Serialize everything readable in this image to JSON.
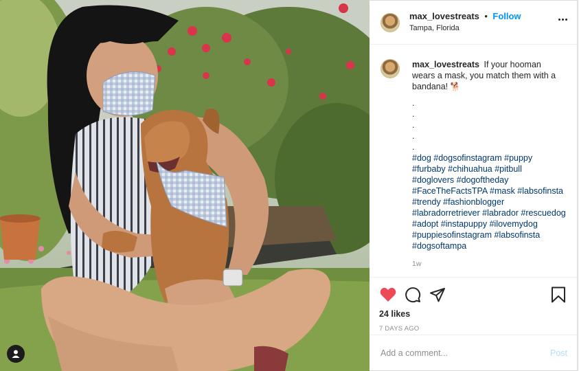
{
  "post": {
    "username": "max_lovestreats",
    "follow_label": "Follow",
    "separator": "•",
    "location": "Tampa, Florida",
    "photo_alt": "Woman in a gingham mask hugging a dog wearing a matching bandana"
  },
  "caption": {
    "username": "max_lovestreats",
    "text": "If your hooman wears a mask, you match them with a bandana!",
    "emoji": "🐕",
    "dots": [
      ".",
      ".",
      ".",
      ".",
      "."
    ],
    "hashtags": "#dog #dogsofinstagram #puppy #furbaby #chihuahua #pitbull #doglovers #dogoftheday #FaceTheFactsTPA #mask #labsofinsta #trendy #fashionblogger #labradorretriever #labrador #rescuedog #adopt #instapuppy #ilovemydog #puppiesofinstagram #labsofinsta #dogsoftampa",
    "age": "1w"
  },
  "actions": {
    "likes": "24 likes",
    "date": "7 DAYS AGO",
    "heart_color": "#ed4956"
  },
  "comment_box": {
    "placeholder": "Add a comment...",
    "post_label": "Post"
  },
  "icons": [
    "heart-icon",
    "comment-icon",
    "share-icon",
    "bookmark-icon",
    "more-icon",
    "tag-user-icon"
  ]
}
